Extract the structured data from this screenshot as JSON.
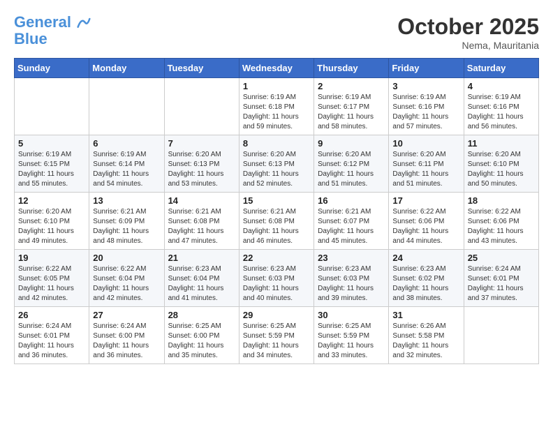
{
  "header": {
    "logo_line1": "General",
    "logo_line2": "Blue",
    "month": "October 2025",
    "location": "Nema, Mauritania"
  },
  "days_of_week": [
    "Sunday",
    "Monday",
    "Tuesday",
    "Wednesday",
    "Thursday",
    "Friday",
    "Saturday"
  ],
  "weeks": [
    [
      {
        "day": "",
        "info": ""
      },
      {
        "day": "",
        "info": ""
      },
      {
        "day": "",
        "info": ""
      },
      {
        "day": "1",
        "info": "Sunrise: 6:19 AM\nSunset: 6:18 PM\nDaylight: 11 hours and 59 minutes."
      },
      {
        "day": "2",
        "info": "Sunrise: 6:19 AM\nSunset: 6:17 PM\nDaylight: 11 hours and 58 minutes."
      },
      {
        "day": "3",
        "info": "Sunrise: 6:19 AM\nSunset: 6:16 PM\nDaylight: 11 hours and 57 minutes."
      },
      {
        "day": "4",
        "info": "Sunrise: 6:19 AM\nSunset: 6:16 PM\nDaylight: 11 hours and 56 minutes."
      }
    ],
    [
      {
        "day": "5",
        "info": "Sunrise: 6:19 AM\nSunset: 6:15 PM\nDaylight: 11 hours and 55 minutes."
      },
      {
        "day": "6",
        "info": "Sunrise: 6:19 AM\nSunset: 6:14 PM\nDaylight: 11 hours and 54 minutes."
      },
      {
        "day": "7",
        "info": "Sunrise: 6:20 AM\nSunset: 6:13 PM\nDaylight: 11 hours and 53 minutes."
      },
      {
        "day": "8",
        "info": "Sunrise: 6:20 AM\nSunset: 6:13 PM\nDaylight: 11 hours and 52 minutes."
      },
      {
        "day": "9",
        "info": "Sunrise: 6:20 AM\nSunset: 6:12 PM\nDaylight: 11 hours and 51 minutes."
      },
      {
        "day": "10",
        "info": "Sunrise: 6:20 AM\nSunset: 6:11 PM\nDaylight: 11 hours and 51 minutes."
      },
      {
        "day": "11",
        "info": "Sunrise: 6:20 AM\nSunset: 6:10 PM\nDaylight: 11 hours and 50 minutes."
      }
    ],
    [
      {
        "day": "12",
        "info": "Sunrise: 6:20 AM\nSunset: 6:10 PM\nDaylight: 11 hours and 49 minutes."
      },
      {
        "day": "13",
        "info": "Sunrise: 6:21 AM\nSunset: 6:09 PM\nDaylight: 11 hours and 48 minutes."
      },
      {
        "day": "14",
        "info": "Sunrise: 6:21 AM\nSunset: 6:08 PM\nDaylight: 11 hours and 47 minutes."
      },
      {
        "day": "15",
        "info": "Sunrise: 6:21 AM\nSunset: 6:08 PM\nDaylight: 11 hours and 46 minutes."
      },
      {
        "day": "16",
        "info": "Sunrise: 6:21 AM\nSunset: 6:07 PM\nDaylight: 11 hours and 45 minutes."
      },
      {
        "day": "17",
        "info": "Sunrise: 6:22 AM\nSunset: 6:06 PM\nDaylight: 11 hours and 44 minutes."
      },
      {
        "day": "18",
        "info": "Sunrise: 6:22 AM\nSunset: 6:06 PM\nDaylight: 11 hours and 43 minutes."
      }
    ],
    [
      {
        "day": "19",
        "info": "Sunrise: 6:22 AM\nSunset: 6:05 PM\nDaylight: 11 hours and 42 minutes."
      },
      {
        "day": "20",
        "info": "Sunrise: 6:22 AM\nSunset: 6:04 PM\nDaylight: 11 hours and 42 minutes."
      },
      {
        "day": "21",
        "info": "Sunrise: 6:23 AM\nSunset: 6:04 PM\nDaylight: 11 hours and 41 minutes."
      },
      {
        "day": "22",
        "info": "Sunrise: 6:23 AM\nSunset: 6:03 PM\nDaylight: 11 hours and 40 minutes."
      },
      {
        "day": "23",
        "info": "Sunrise: 6:23 AM\nSunset: 6:03 PM\nDaylight: 11 hours and 39 minutes."
      },
      {
        "day": "24",
        "info": "Sunrise: 6:23 AM\nSunset: 6:02 PM\nDaylight: 11 hours and 38 minutes."
      },
      {
        "day": "25",
        "info": "Sunrise: 6:24 AM\nSunset: 6:01 PM\nDaylight: 11 hours and 37 minutes."
      }
    ],
    [
      {
        "day": "26",
        "info": "Sunrise: 6:24 AM\nSunset: 6:01 PM\nDaylight: 11 hours and 36 minutes."
      },
      {
        "day": "27",
        "info": "Sunrise: 6:24 AM\nSunset: 6:00 PM\nDaylight: 11 hours and 36 minutes."
      },
      {
        "day": "28",
        "info": "Sunrise: 6:25 AM\nSunset: 6:00 PM\nDaylight: 11 hours and 35 minutes."
      },
      {
        "day": "29",
        "info": "Sunrise: 6:25 AM\nSunset: 5:59 PM\nDaylight: 11 hours and 34 minutes."
      },
      {
        "day": "30",
        "info": "Sunrise: 6:25 AM\nSunset: 5:59 PM\nDaylight: 11 hours and 33 minutes."
      },
      {
        "day": "31",
        "info": "Sunrise: 6:26 AM\nSunset: 5:58 PM\nDaylight: 11 hours and 32 minutes."
      },
      {
        "day": "",
        "info": ""
      }
    ]
  ]
}
